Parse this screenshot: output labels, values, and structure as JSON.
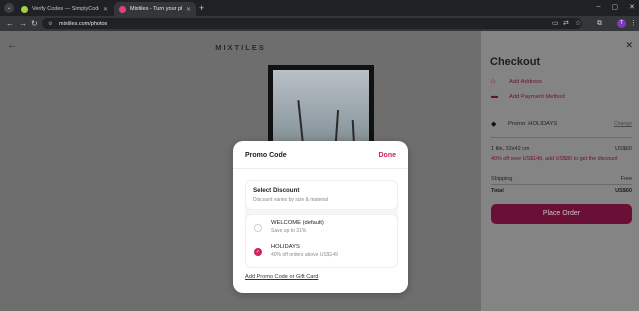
{
  "browser": {
    "tabs": [
      {
        "title": "Verify Codes — SimplyCodes",
        "favicon": "check-badge-icon"
      },
      {
        "title": "Mixtiles - Turn your photos into...",
        "favicon": "mixtiles-icon"
      }
    ],
    "url": "mixtiles.com/photos",
    "profile_initial": "T"
  },
  "page": {
    "brand": "MIXTILES"
  },
  "checkout": {
    "title": "Checkout",
    "add_address": "Add Address",
    "add_payment": "Add Payment Method",
    "promo": "Promo: HOLIDAYS",
    "change": "Change",
    "tile_desc": "1 tile, 32x42 cm",
    "tile_price": "US$60",
    "offer": "40% off over US$149, add US$80 to get the discount",
    "shipping_label": "Shipping",
    "shipping_value": "Free",
    "total_label": "Total",
    "total_value": "US$60",
    "place_order": "Place Order"
  },
  "modal": {
    "title": "Promo Code",
    "done": "Done",
    "select_title": "Select Discount",
    "select_sub": "Discount varies by size & material",
    "options": [
      {
        "name": "WELCOME (default)",
        "desc": "Save up to 31%",
        "selected": false
      },
      {
        "name": "HOLIDAYS",
        "desc": "40% off orders above US$149",
        "selected": true
      }
    ],
    "add_link": "Add Promo Code or Gift Card"
  },
  "colors": {
    "accent": "#d61f5f",
    "place_order_bg": "#6a1036"
  }
}
